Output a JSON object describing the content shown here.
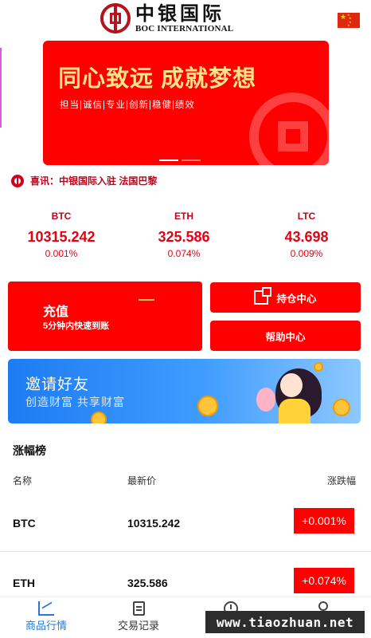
{
  "header": {
    "brand_cn": "中银国际",
    "brand_en": "BOC INTERNATIONAL",
    "flag_icon": "china-flag-icon"
  },
  "banner": {
    "title": "同心致远  成就梦想",
    "subtitle": "担当|诚信|专业|创新|稳健|绩效",
    "slide_count": 2,
    "active_slide": 1
  },
  "news": {
    "text": "喜讯：中银国际入驻 法国巴黎"
  },
  "tickers": [
    {
      "symbol": "BTC",
      "price": "10315.242",
      "change": "0.001%"
    },
    {
      "symbol": "ETH",
      "price": "325.586",
      "change": "0.074%"
    },
    {
      "symbol": "LTC",
      "price": "43.698",
      "change": "0.009%"
    }
  ],
  "actions": {
    "deposit_title": "充值",
    "deposit_sub": "5分钟内快速到账",
    "positions": "持仓中心",
    "help": "帮助中心"
  },
  "invite": {
    "title": "邀请好友",
    "subtitle": "创造财富 共享财富"
  },
  "ranking": {
    "title": "涨幅榜",
    "columns": [
      "名称",
      "最新价",
      "涨跌幅"
    ],
    "rows": [
      {
        "symbol": "BTC",
        "price": "10315.242",
        "change": "+0.001%"
      },
      {
        "symbol": "ETH",
        "price": "325.586",
        "change": "+0.074%"
      }
    ]
  },
  "tabbar": {
    "items": [
      {
        "label": "商品行情",
        "icon": "chart-icon",
        "active": true
      },
      {
        "label": "交易记录",
        "icon": "document-icon",
        "active": false
      },
      {
        "label": "",
        "icon": "clock-icon",
        "active": false
      },
      {
        "label": "",
        "icon": "user-icon",
        "active": false
      }
    ]
  },
  "watermark": "www.tiaozhuan.net",
  "colors": {
    "primary_red": "#ff0000",
    "dark_red": "#c4001a",
    "tab_active": "#2a78d3",
    "banner_gold": "#ffe48a"
  }
}
